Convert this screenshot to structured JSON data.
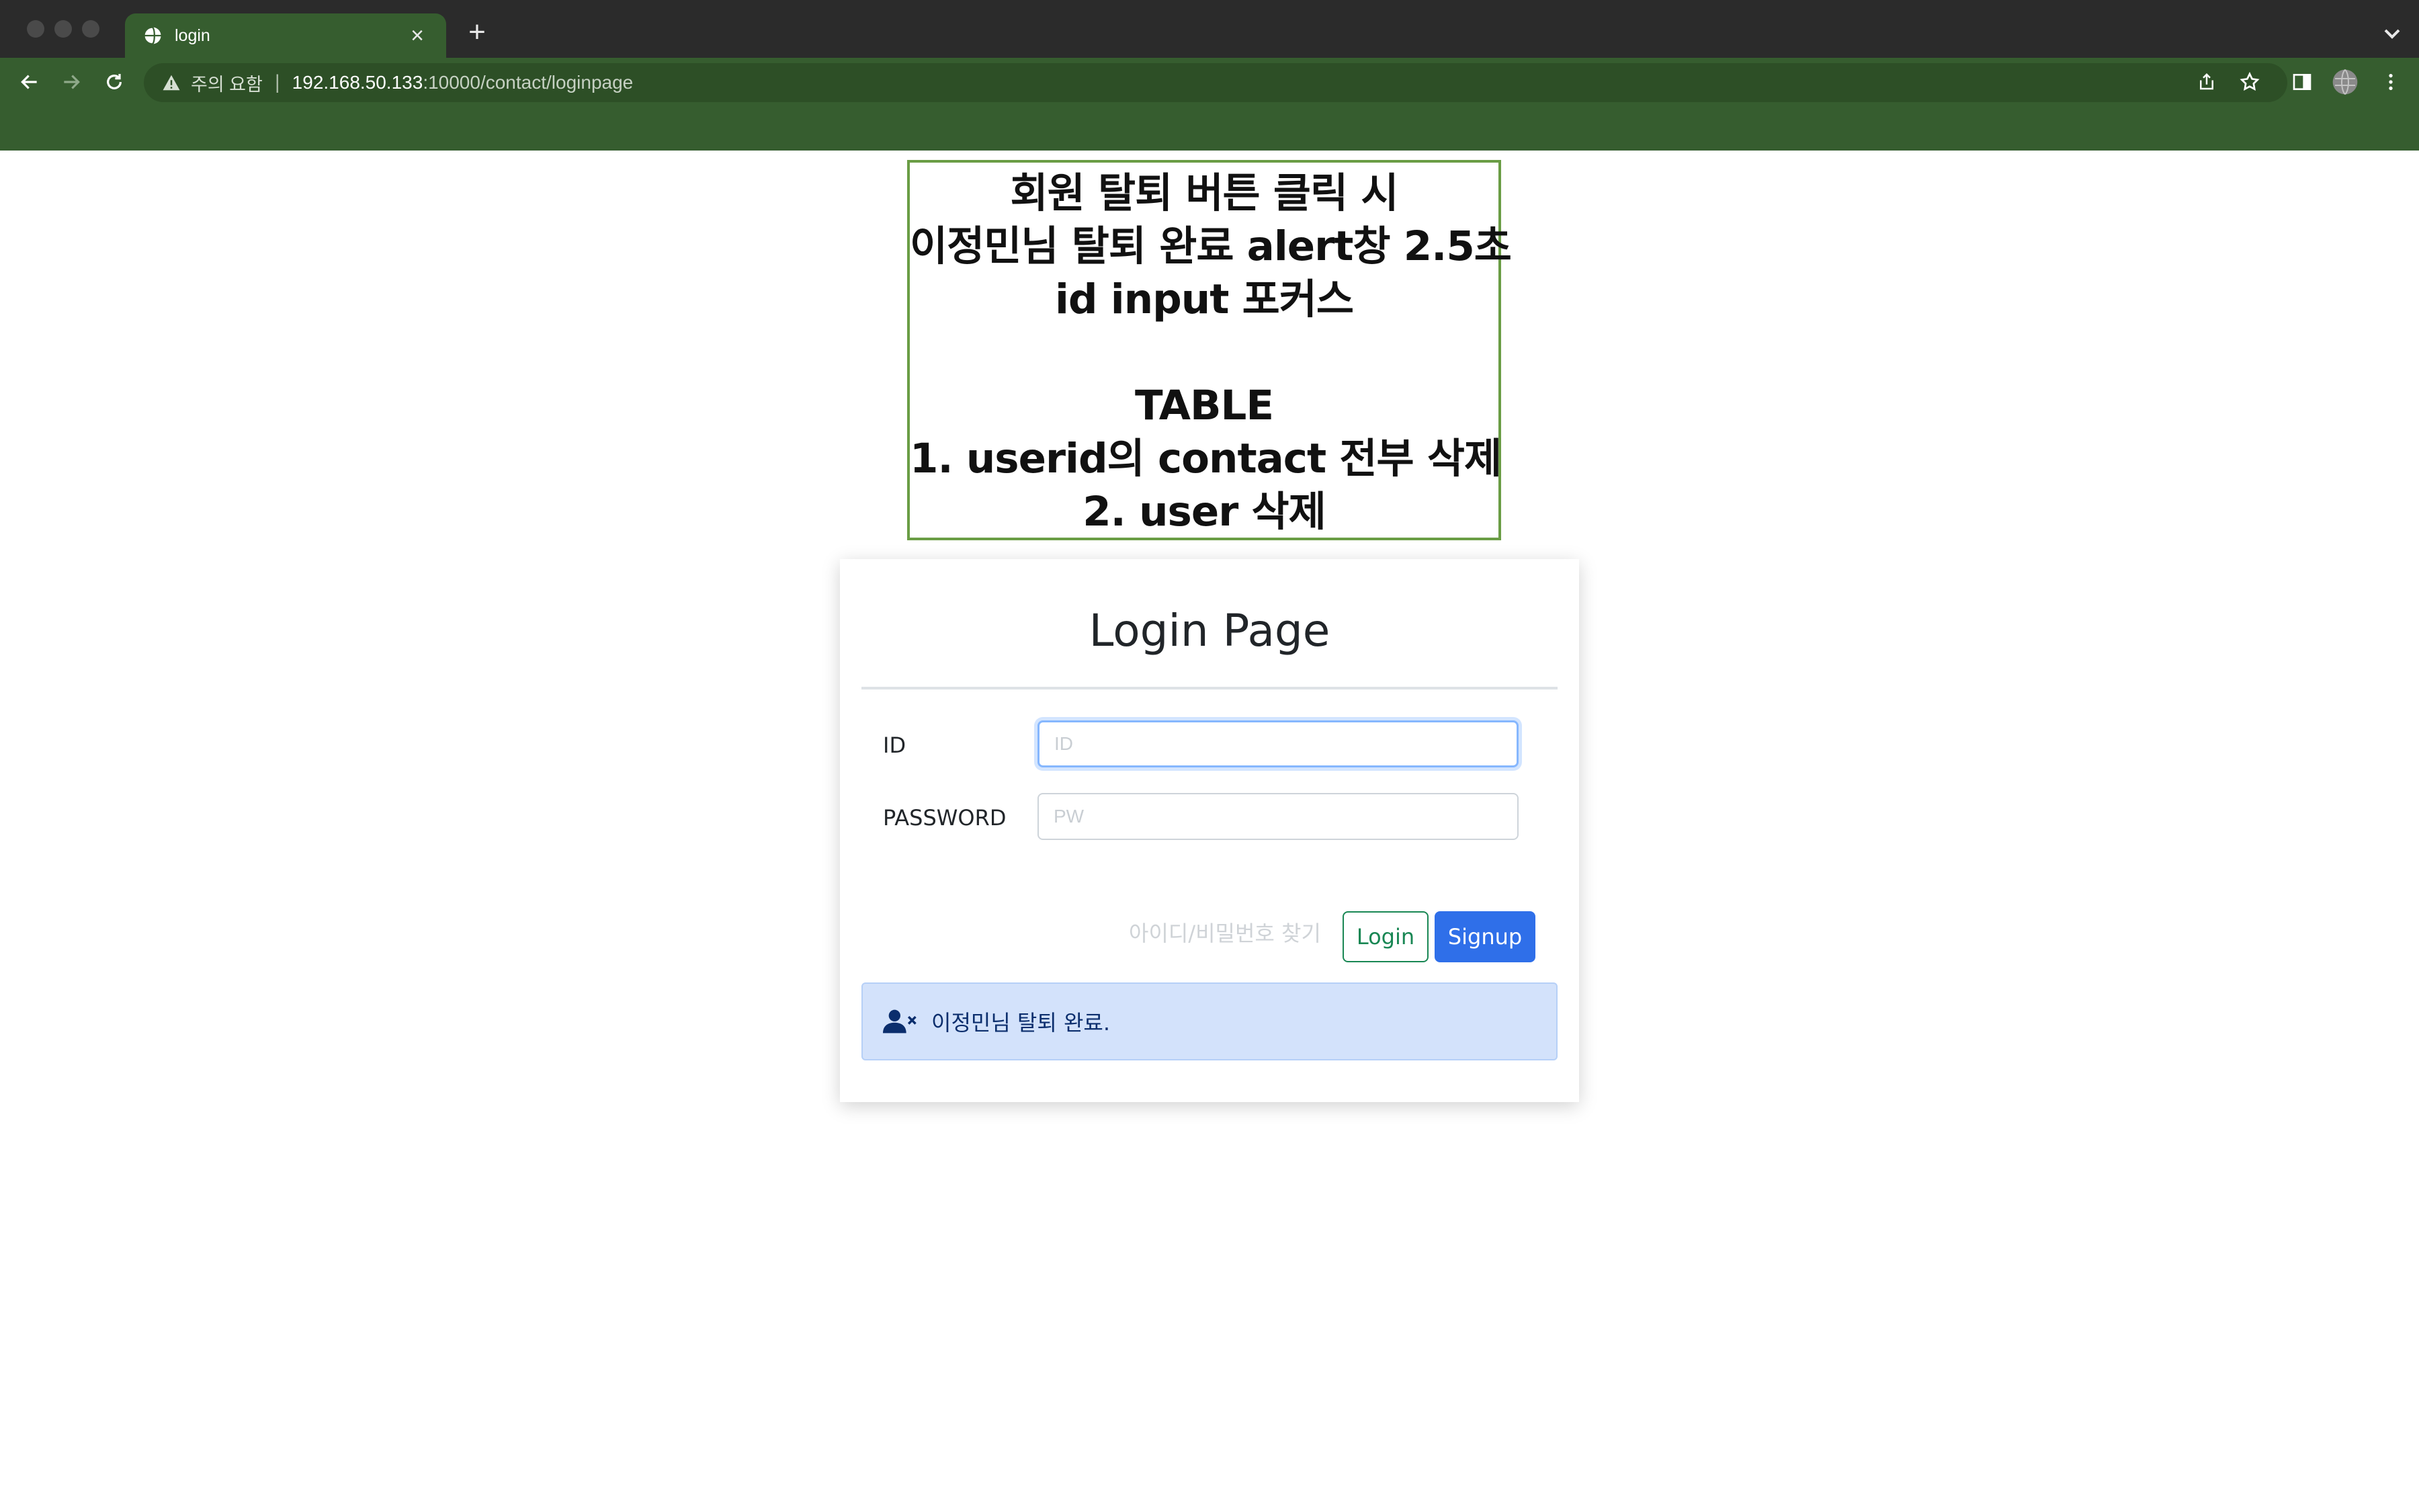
{
  "browser": {
    "tab_title": "login",
    "close_symbol": "×",
    "new_tab_symbol": "+",
    "security_label": "주의 요함",
    "separator": "|",
    "url_host": "192.168.50.133",
    "url_rest": ":10000/contact/loginpage"
  },
  "note": {
    "lines": [
      "회원 탈퇴 버튼 클릭 시",
      "이정민님 탈퇴 완료 alert창 2.5초",
      "id input 포커스",
      "",
      "TABLE",
      "1. userid의 contact 전부 삭제",
      "2. user 삭제"
    ]
  },
  "login": {
    "title": "Login Page",
    "id_label": "ID",
    "id_placeholder": "ID",
    "pw_label": "PASSWORD",
    "pw_placeholder": "PW",
    "find_link": "아이디/비밀번호 찾기",
    "login_button": "Login",
    "signup_button": "Signup",
    "alert_text": "이정민님 탈퇴 완료."
  },
  "colors": {
    "chrome_tabbar": "#2b2b2b",
    "chrome_toolbar": "#365d2f",
    "note_border": "#6a9d45",
    "login_button": "#198754",
    "signup_button": "#2f6fe9",
    "alert_background": "#d3e2fb"
  },
  "icons": {
    "tab_favicon": "globe-icon",
    "back": "back-arrow-icon",
    "forward": "forward-arrow-icon",
    "reload": "reload-icon",
    "security": "warning-triangle-icon",
    "share": "share-icon",
    "bookmark": "star-icon",
    "side_panel": "side-panel-icon",
    "profile": "profile-avatar-icon",
    "menu": "kebab-menu-icon",
    "alert": "user-remove-icon"
  }
}
